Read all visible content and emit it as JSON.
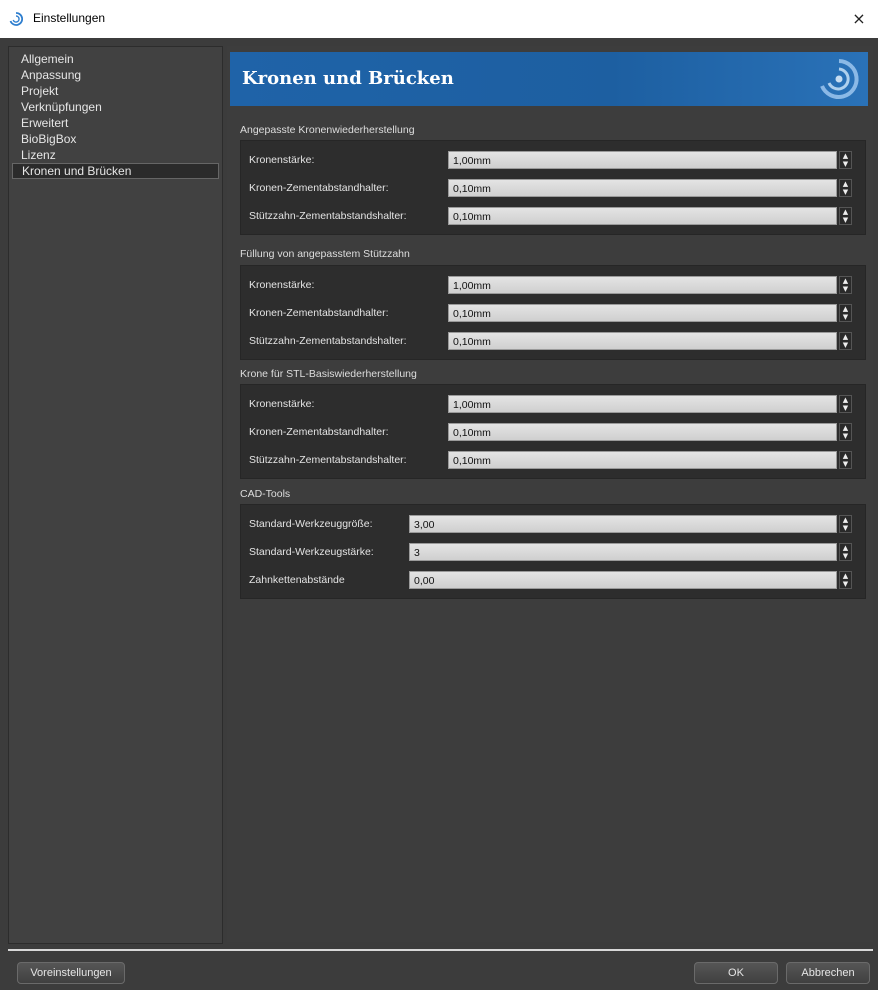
{
  "window": {
    "title": "Einstellungen",
    "close_glyph": "×"
  },
  "sidebar": {
    "items": [
      {
        "label": "Allgemein"
      },
      {
        "label": "Anpassung"
      },
      {
        "label": "Projekt"
      },
      {
        "label": "Verknüpfungen"
      },
      {
        "label": "Erweitert"
      },
      {
        "label": "BioBigBox"
      },
      {
        "label": "Lizenz"
      },
      {
        "label": "Kronen und Brücken"
      }
    ],
    "selected": "Kronen und Brücken"
  },
  "banner": {
    "title": "Kronen und Brücken",
    "logo_icon": "spiral-logo-icon"
  },
  "groups": [
    {
      "title": "Angepasste Kronenwiederherstellung",
      "rows": [
        {
          "label": "Kronenstärke:",
          "value": "1,00mm"
        },
        {
          "label": "Kronen-Zementabstandhalter:",
          "value": "0,10mm"
        },
        {
          "label": "Stützzahn-Zementabstandshalter:",
          "value": "0,10mm"
        }
      ]
    },
    {
      "title": "Füllung von angepasstem Stützzahn",
      "rows": [
        {
          "label": "Kronenstärke:",
          "value": "1,00mm"
        },
        {
          "label": "Kronen-Zementabstandhalter:",
          "value": "0,10mm"
        },
        {
          "label": "Stützzahn-Zementabstandshalter:",
          "value": "0,10mm"
        }
      ]
    },
    {
      "title": "Krone für STL-Basiswiederherstellung",
      "rows": [
        {
          "label": "Kronenstärke:",
          "value": "1,00mm"
        },
        {
          "label": "Kronen-Zementabstandhalter:",
          "value": "0,10mm"
        },
        {
          "label": "Stützzahn-Zementabstandshalter:",
          "value": "0,10mm"
        }
      ]
    },
    {
      "title": "CAD-Tools",
      "rows": [
        {
          "label": "Standard-Werkzeuggröße:",
          "value": "3,00"
        },
        {
          "label": "Standard-Werkzeugstärke:",
          "value": "3"
        },
        {
          "label": "Zahnkettenabstände",
          "value": "0,00"
        }
      ]
    }
  ],
  "spin_glyphs": {
    "up": "▲",
    "down": "▼"
  },
  "footer": {
    "defaults_label": "Voreinstellungen",
    "ok_label": "OK",
    "cancel_label": "Abbrechen"
  },
  "colors": {
    "banner_blue": "#1f63a8",
    "panel_bg": "#3d3d3d",
    "group_bg": "#2d2d2d"
  }
}
